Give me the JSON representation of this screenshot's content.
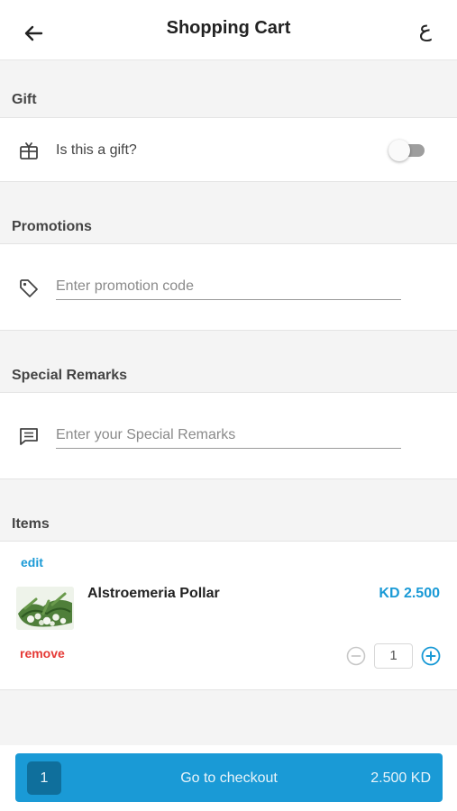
{
  "header": {
    "title": "Shopping Cart",
    "language_toggle": "ع",
    "back_icon": "arrow-left-icon"
  },
  "gift": {
    "section_title": "Gift",
    "label": "Is this a gift?",
    "icon": "gift-icon",
    "toggle_on": false
  },
  "promotions": {
    "section_title": "Promotions",
    "placeholder": "Enter promotion code",
    "value": "",
    "icon": "tag-icon"
  },
  "remarks": {
    "section_title": "Special Remarks",
    "placeholder": "Enter your Special Remarks",
    "value": "",
    "icon": "comment-icon"
  },
  "items": {
    "section_title": "Items",
    "list": [
      {
        "edit_label": "edit",
        "name": "Alstroemeria Pollar",
        "price": "KD 2.500",
        "remove_label": "remove",
        "quantity": "1"
      }
    ]
  },
  "checkout": {
    "count": "1",
    "label": "Go to checkout",
    "total": "2.500 KD"
  },
  "colors": {
    "accent": "#1a9ad6",
    "accent_dark": "#0f6f9c",
    "danger": "#e53935",
    "toggle_track": "#9e9e9e"
  }
}
